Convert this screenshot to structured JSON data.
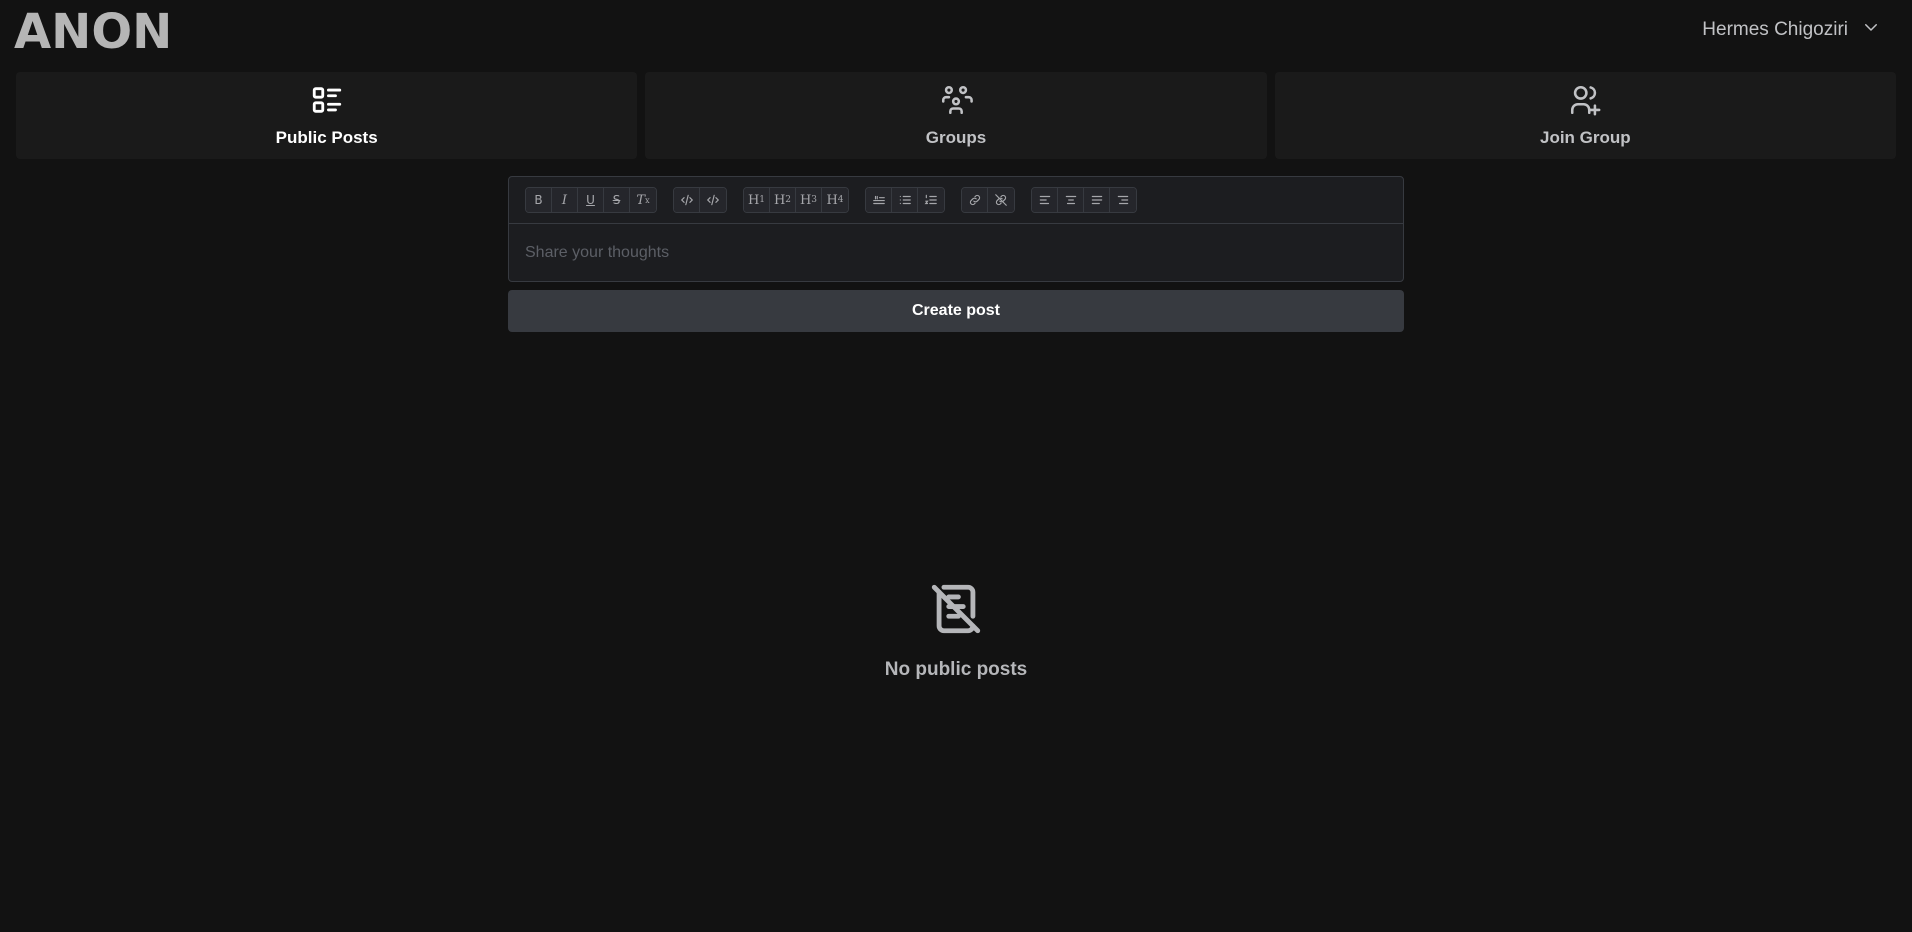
{
  "header": {
    "logo": "ANON",
    "user_name": "Hermes Chigoziri",
    "user_menu_icon": "chevron-down-icon"
  },
  "tabs": [
    {
      "label": "Public Posts",
      "icon": "list-details-icon",
      "active": true
    },
    {
      "label": "Groups",
      "icon": "users-group-icon",
      "active": false
    },
    {
      "label": "Join Group",
      "icon": "user-plus-icon",
      "active": false
    }
  ],
  "editor": {
    "placeholder": "Share your thoughts",
    "toolbar_groups": [
      [
        "bold-icon",
        "italic-icon",
        "underline-icon",
        "strikethrough-icon",
        "clear-formatting-icon"
      ],
      [
        "code-icon",
        "code-block-icon"
      ],
      [
        "h1-icon",
        "h2-icon",
        "h3-icon",
        "h4-icon"
      ],
      [
        "blockquote-icon",
        "bullet-list-icon",
        "ordered-list-icon"
      ],
      [
        "link-icon",
        "unlink-icon"
      ],
      [
        "align-left-icon",
        "align-center-icon",
        "align-justify-icon",
        "align-right-icon"
      ]
    ],
    "heading_labels": {
      "h1": "H",
      "h1_sub": "1",
      "h2": "H",
      "h2_sub": "2",
      "h3": "H",
      "h3_sub": "3",
      "h4": "H",
      "h4_sub": "4"
    },
    "format_labels": {
      "bold": "B",
      "italic": "I",
      "underline": "U",
      "strike": "S",
      "clear": "T"
    }
  },
  "create_button": {
    "label": "Create post"
  },
  "empty_state": {
    "icon": "file-off-icon",
    "message": "No public posts"
  },
  "colors": {
    "background": "#121212",
    "surface": "#1a1a1a",
    "border": "#373a40",
    "button": "#373a40"
  }
}
